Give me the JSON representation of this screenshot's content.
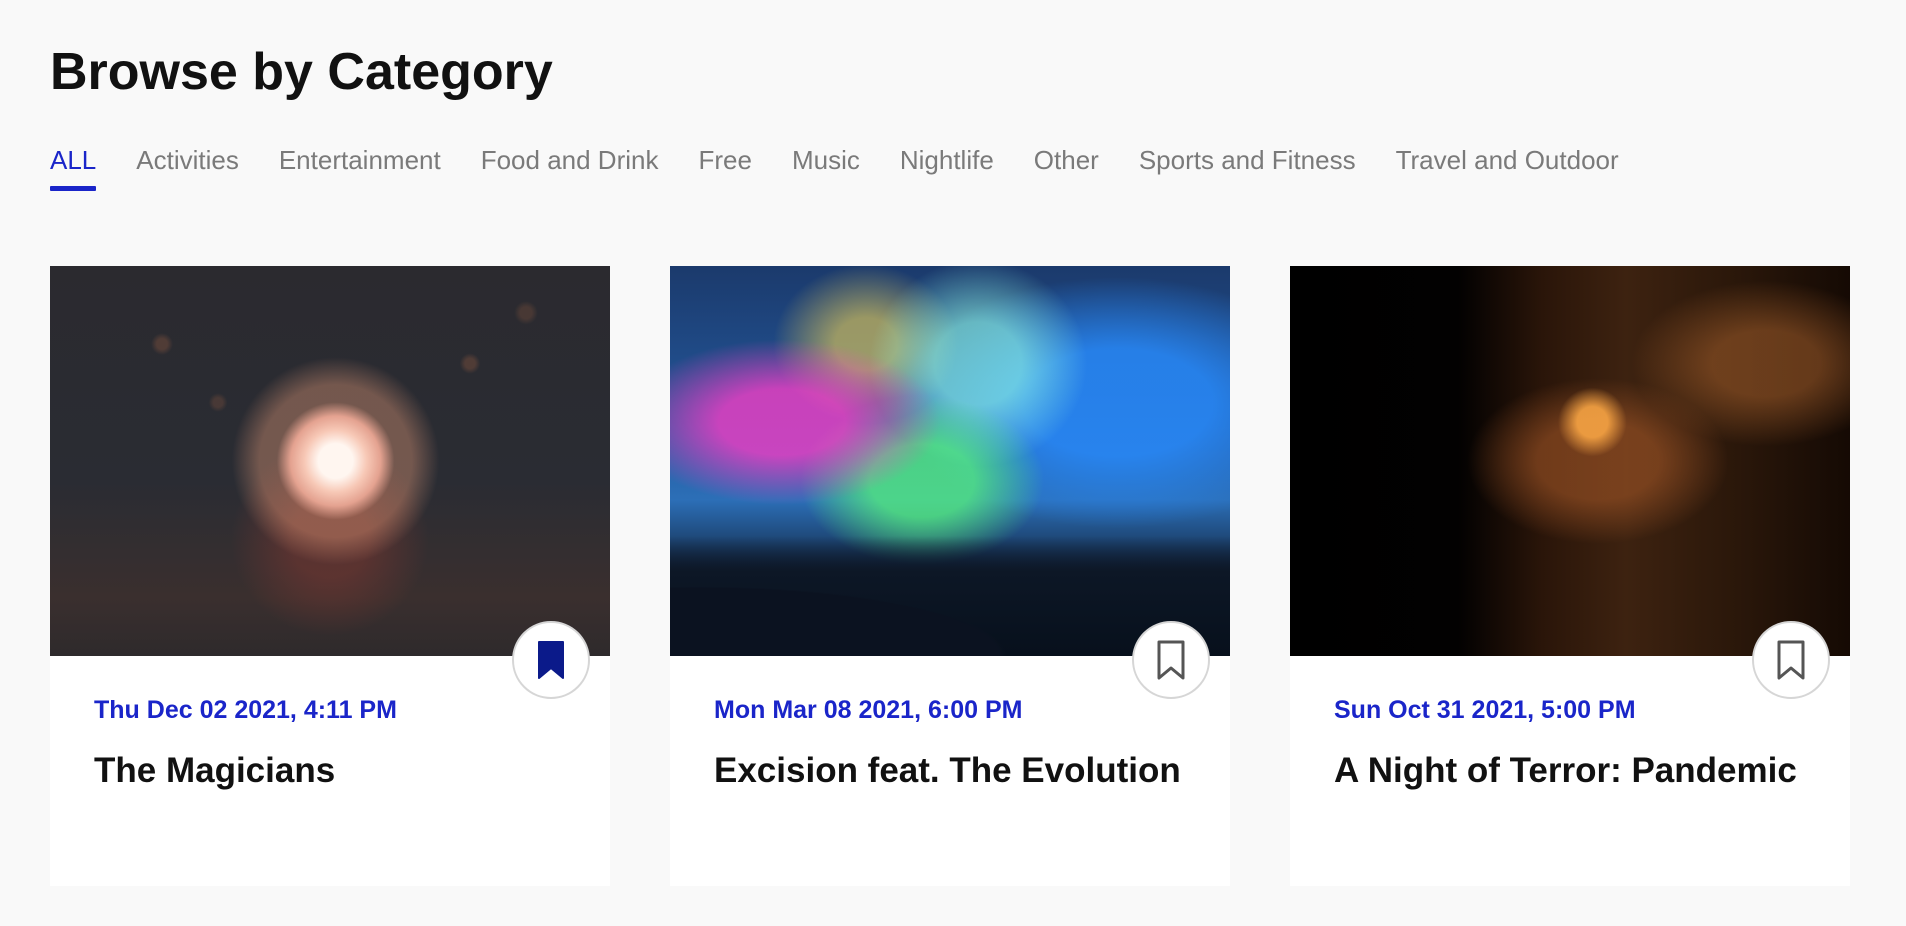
{
  "page": {
    "title": "Browse by Category"
  },
  "tabs": [
    {
      "label": "ALL",
      "active": true
    },
    {
      "label": "Activities",
      "active": false
    },
    {
      "label": "Entertainment",
      "active": false
    },
    {
      "label": "Food and Drink",
      "active": false
    },
    {
      "label": "Free",
      "active": false
    },
    {
      "label": "Music",
      "active": false
    },
    {
      "label": "Nightlife",
      "active": false
    },
    {
      "label": "Other",
      "active": false
    },
    {
      "label": "Sports and Fitness",
      "active": false
    },
    {
      "label": "Travel and Outdoor",
      "active": false
    }
  ],
  "events": [
    {
      "date": "Thu Dec 02 2021, 4:11 PM",
      "name": "The Magicians",
      "bookmarked": true,
      "image_icon": "plasma-ball-photo"
    },
    {
      "date": "Mon Mar 08 2021, 6:00 PM",
      "name": "Excision feat. The Evolution",
      "bookmarked": false,
      "image_icon": "concert-photo"
    },
    {
      "date": "Sun Oct 31 2021, 5:00 PM",
      "name": "A Night of Terror: Pandemic",
      "bookmarked": false,
      "image_icon": "scarecrow-photo"
    }
  ],
  "colors": {
    "accent": "#1a25c9",
    "bookmark_filled": "#0b1a8a",
    "tab_inactive": "#7a7a7a",
    "background": "#f9f9f9"
  }
}
